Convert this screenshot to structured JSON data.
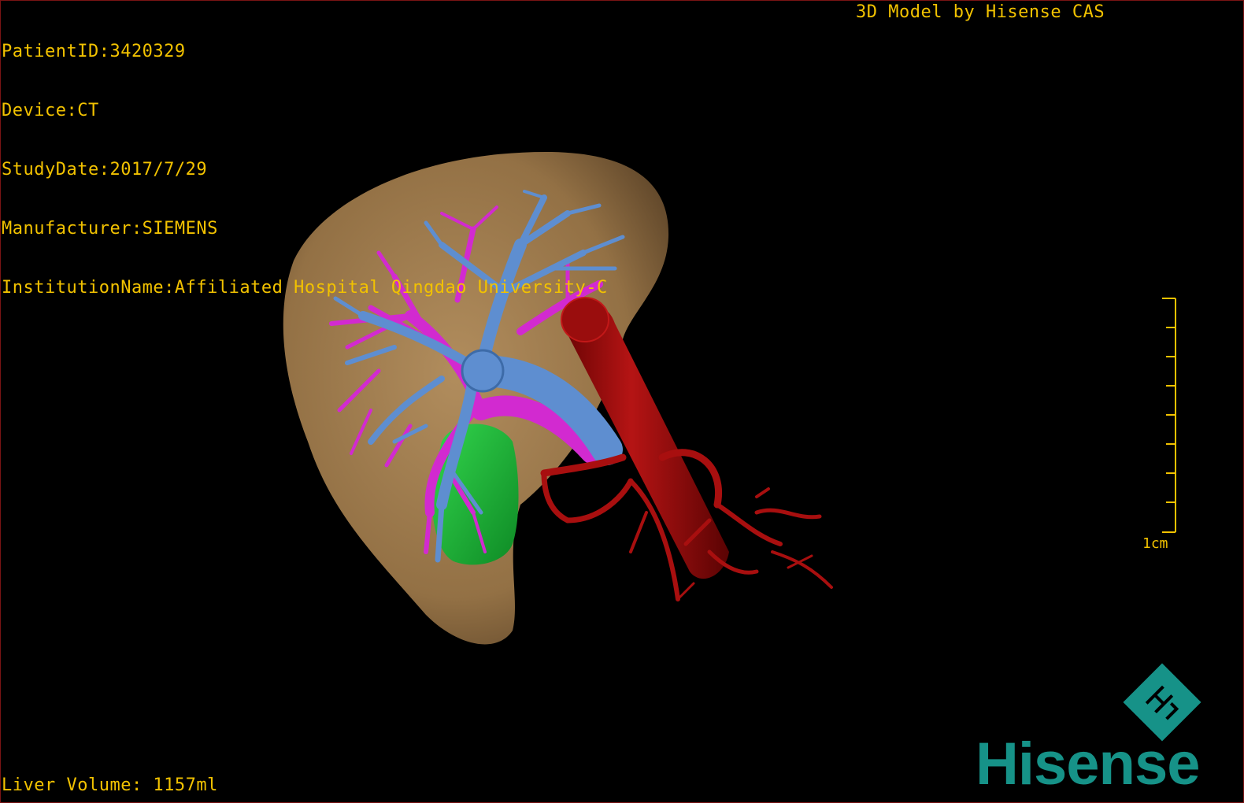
{
  "info": {
    "patient_id": "PatientID:3420329",
    "device": "Device:CT",
    "study_date": "StudyDate:2017/7/29",
    "manufacturer": "Manufacturer:SIEMENS",
    "institution": "InstitutionName:Affiliated Hospital Qingdao University-C"
  },
  "credit": "3D Model by Hisense CAS",
  "liver_volume": "Liver Volume: 1157ml",
  "scale_bar": {
    "label": "1cm",
    "ticks": 9
  },
  "brand": {
    "name": "Hisense",
    "color": "#169288",
    "logo_icon": "hisense-h-diamond-logo"
  },
  "model_colors": {
    "liver": "#b58a55",
    "hepatic_veins": "#5e8ed0",
    "portal_vein": "#d22ad0",
    "gallbladder": "#1fb83a",
    "aorta_arteries": "#a80f0f",
    "overlay_text": "#f2c200"
  }
}
